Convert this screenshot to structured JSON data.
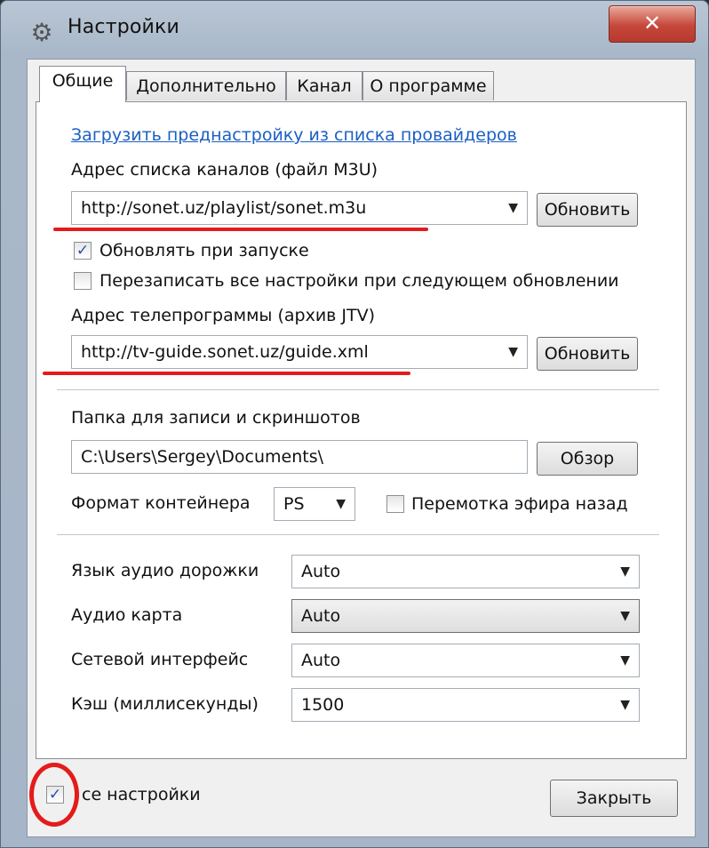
{
  "window": {
    "title": "Настройки",
    "close_glyph": "✕"
  },
  "tabs": [
    {
      "label": "Общие",
      "active": true
    },
    {
      "label": "Дополнительно",
      "active": false
    },
    {
      "label": "Канал",
      "active": false
    },
    {
      "label": "О программе",
      "active": false
    }
  ],
  "general": {
    "provider_link": "Загрузить преднастройку из списка провайдеров",
    "playlist_label": "Адрес списка каналов (файл M3U)",
    "playlist_value": "http://sonet.uz/playlist/sonet.m3u",
    "update_button": "Обновить",
    "update_on_start_label": "Обновлять при запуске",
    "update_on_start_checked": true,
    "overwrite_label": "Перезаписать все настройки при следующем обновлении",
    "overwrite_checked": false,
    "epg_label": "Адрес телепрограммы (архив JTV)",
    "epg_value": "http://tv-guide.sonet.uz/guide.xml",
    "epg_update_button": "Обновить",
    "folder_label": "Папка для записи и скриншотов",
    "folder_value": "C:\\Users\\Sergey\\Documents\\",
    "browse_button": "Обзор",
    "container_label": "Формат контейнера",
    "container_value": "PS",
    "rewind_label": "Перемотка эфира назад",
    "rewind_checked": false,
    "audio_track_label": "Язык аудио дорожки",
    "audio_track_value": "Auto",
    "audio_card_label": "Аудио карта",
    "audio_card_value": "Auto",
    "network_label": "Сетевой интерфейс",
    "network_value": "Auto",
    "cache_label": "Кэш (миллисекунды)",
    "cache_value": "1500"
  },
  "footer": {
    "all_settings_label": "се настройки",
    "all_settings_checked": true,
    "close_button": "Закрыть"
  },
  "glyphs": {
    "check": "✓",
    "dropdown": "▼",
    "gear": "⚙"
  },
  "colors": {
    "annotation_red": "#e41b1b",
    "link_blue": "#1b5fc2"
  }
}
